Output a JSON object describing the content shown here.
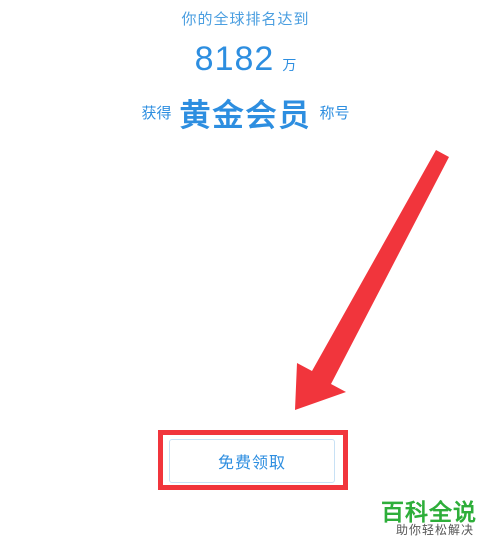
{
  "rank": {
    "intro": "你的全球排名达到",
    "number": "8182",
    "unit": "万"
  },
  "title": {
    "prefix": "获得",
    "name": "黄金会员",
    "suffix": "称号"
  },
  "claim_button": {
    "label": "免费领取"
  },
  "watermark": {
    "title": "百科全说",
    "subtitle": "助你轻松解决"
  },
  "colors": {
    "text_blue": "#2d8ee0",
    "annotation_red": "#f1353c",
    "watermark_green": "#2eae3a"
  }
}
